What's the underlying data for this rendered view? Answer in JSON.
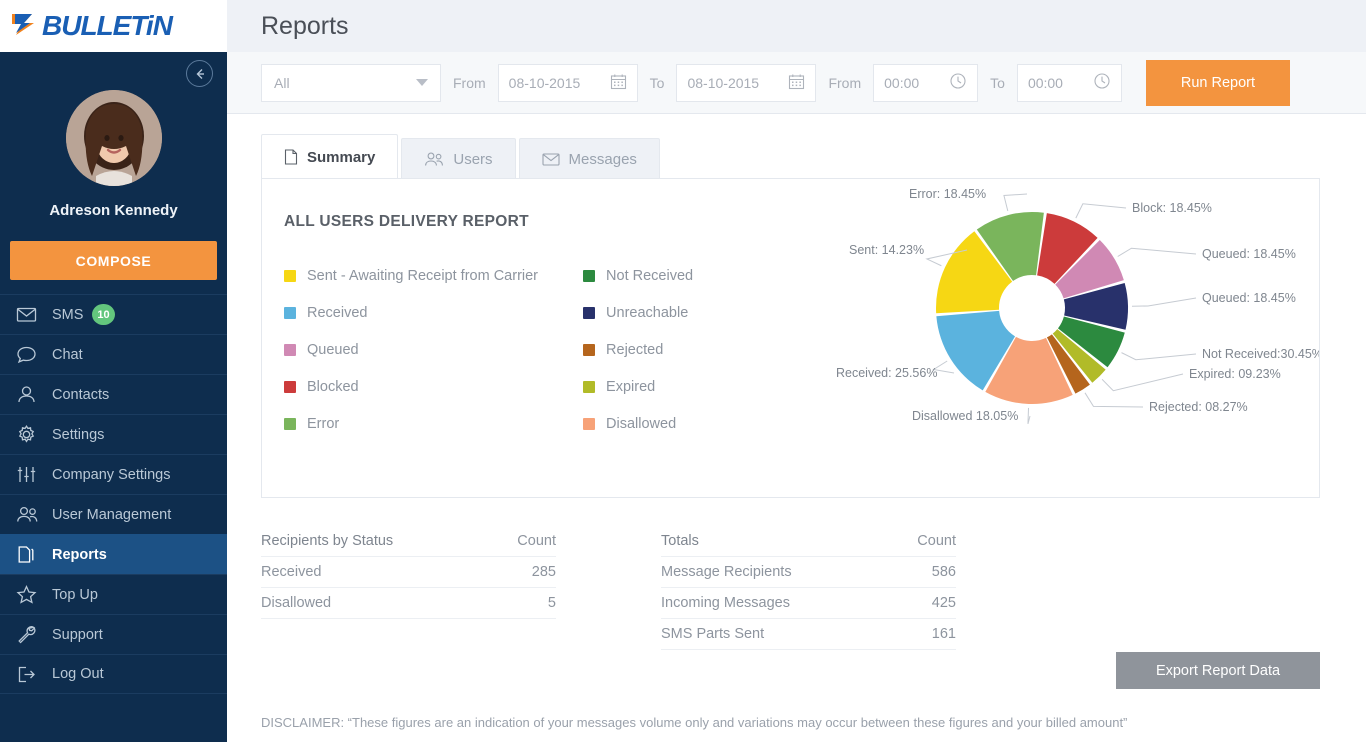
{
  "brand": {
    "name": "BULLETiN",
    "logo_icon": "bulletin-logo-icon"
  },
  "sidebar": {
    "collapse_icon": "arrow-left-circle-icon",
    "avatar_alt": "user-avatar",
    "user_name": "Adreson Kennedy",
    "compose_label": "COMPOSE",
    "items": [
      {
        "label": "SMS",
        "icon": "envelope-icon",
        "badge": "10",
        "active": false
      },
      {
        "label": "Chat",
        "icon": "chat-bubble-icon",
        "badge": null,
        "active": false
      },
      {
        "label": "Contacts",
        "icon": "user-icon",
        "badge": null,
        "active": false
      },
      {
        "label": "Settings",
        "icon": "gear-icon",
        "badge": null,
        "active": false
      },
      {
        "label": "Company Settings",
        "icon": "sliders-icon",
        "badge": null,
        "active": false
      },
      {
        "label": "User Management",
        "icon": "users-icon",
        "badge": null,
        "active": false
      },
      {
        "label": "Reports",
        "icon": "documents-icon",
        "badge": null,
        "active": true
      },
      {
        "label": "Top Up",
        "icon": "star-icon",
        "badge": null,
        "active": false
      },
      {
        "label": "Support",
        "icon": "wrench-icon",
        "badge": null,
        "active": false
      },
      {
        "label": "Log Out",
        "icon": "logout-icon",
        "badge": null,
        "active": false
      }
    ]
  },
  "header": {
    "title": "Reports"
  },
  "filterbar": {
    "select_value": "All",
    "select_icon": "chevron-down-icon",
    "date_from_label": "From",
    "date_from_value": "08-10-2015",
    "date_to_label": "To",
    "date_to_value": "08-10-2015",
    "date_icon": "calendar-icon",
    "time_from_label": "From",
    "time_from_value": "00:00",
    "time_to_label": "To",
    "time_to_value": "00:00",
    "time_icon": "clock-icon",
    "run_label": "Run Report"
  },
  "tabs": [
    {
      "label": "Summary",
      "icon": "document-icon",
      "active": true
    },
    {
      "label": "Users",
      "icon": "users-icon",
      "active": false
    },
    {
      "label": "Messages",
      "icon": "envelope-icon",
      "active": false
    }
  ],
  "report": {
    "title": "ALL USERS DELIVERY REPORT",
    "legend_left": [
      {
        "label": "Sent - Awaiting Receipt from Carrier",
        "color": "#f6d714"
      },
      {
        "label": " Received",
        "color": "#5bb3de"
      },
      {
        "label": "Queued",
        "color": "#d089b4"
      },
      {
        "label": "Blocked",
        "color": "#cc3b3b"
      },
      {
        "label": "Error",
        "color": "#7ab55c"
      }
    ],
    "legend_right": [
      {
        "label": "Not Received",
        "color": "#2c8a3f"
      },
      {
        "label": "Unreachable",
        "color": "#28316b"
      },
      {
        "label": "Rejected",
        "color": "#b5651d"
      },
      {
        "label": "Expired",
        "color": "#b1bb28"
      },
      {
        "label": "Disallowed",
        "color": "#f7a278"
      }
    ]
  },
  "chart_data": {
    "type": "pie",
    "title": "ALL USERS DELIVERY REPORT",
    "donut": true,
    "legend_position": "left",
    "labels": [
      "Block: 18.45%",
      "Queued: 18.45%",
      "Queued: 18.45%",
      "Not Received:30.45%",
      "Expired: 09.23%",
      "Rejected: 08.27%",
      "Disallowed 18.05%",
      "Received: 25.56%",
      "Sent: 14.23%",
      "Error: 18.45%"
    ],
    "categories": [
      "Block",
      "Queued",
      "Queued",
      "Not Received",
      "Expired",
      "Rejected",
      "Disallowed",
      "Received",
      "Sent",
      "Error"
    ],
    "values": [
      18.45,
      18.45,
      18.45,
      30.45,
      9.23,
      8.27,
      18.05,
      25.56,
      14.23,
      18.45
    ],
    "colors": [
      "#cc3b3b",
      "#d089b4",
      "#28316b",
      "#2c8a3f",
      "#b1bb28",
      "#b5651d",
      "#f7a278",
      "#5bb3de",
      "#f6d714",
      "#7ab55c"
    ],
    "slice_spans_deg": [
      36,
      30,
      30,
      25,
      13,
      12,
      56,
      56,
      58,
      44
    ],
    "start_angle_deg": -82
  },
  "tables": [
    {
      "header": {
        "label": "Recipients by Status",
        "count": "Count"
      },
      "rows": [
        {
          "label": "Received",
          "count": "285"
        },
        {
          "label": "Disallowed",
          "count": "5"
        }
      ]
    },
    {
      "header": {
        "label": "Totals",
        "count": "Count"
      },
      "rows": [
        {
          "label": "Message Recipients",
          "count": "586"
        },
        {
          "label": "Incoming Messages",
          "count": "425"
        },
        {
          "label": "SMS Parts Sent",
          "count": "161"
        }
      ]
    }
  ],
  "export_label": "Export Report Data",
  "disclaimer": "DISCLAIMER:  “These figures are an indication of your messages volume only and variations may occur between these figures and your billed amount”",
  "colors": {
    "sidebar_bg": "#0e2d4e",
    "sidebar_active": "#1c5185",
    "accent_orange": "#f3943f",
    "badge_green": "#63c67d",
    "brand_blue": "#1a5fb4"
  }
}
